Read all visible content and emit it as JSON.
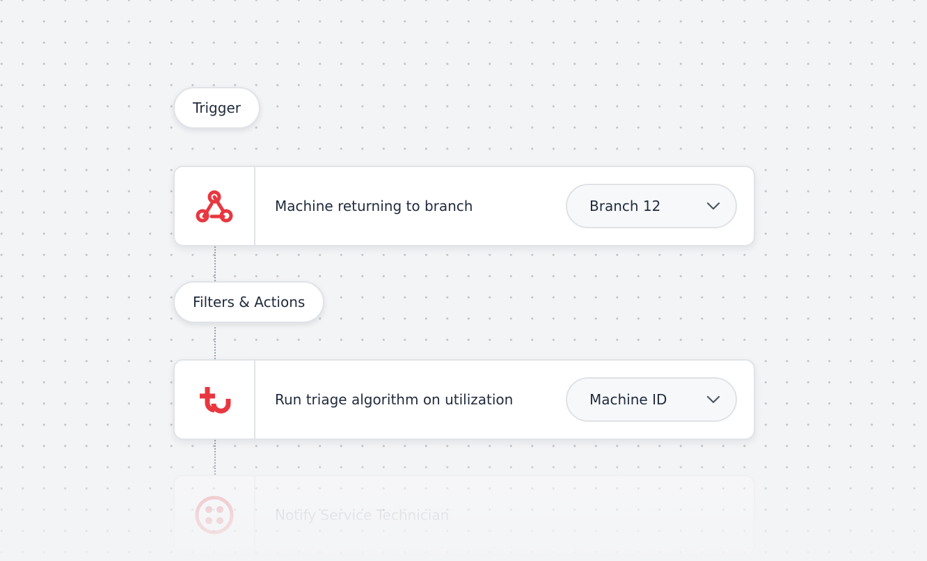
{
  "workflow": {
    "trigger_label": "Trigger",
    "filters_label": "Filters & Actions",
    "steps": [
      {
        "title": "Machine returning to branch",
        "icon": "webhook-icon",
        "select_value": "Branch 12"
      },
      {
        "title": "Run triage algorithm on utilization",
        "icon": "triage-icon",
        "select_value": "Machine ID"
      },
      {
        "title": "Notify Service Technician",
        "icon": "twilio-icon"
      }
    ]
  },
  "colors": {
    "accent": "#e8373f",
    "background": "#f3f4f6",
    "text": "#1f2a3c",
    "border": "#e0e3e7"
  }
}
